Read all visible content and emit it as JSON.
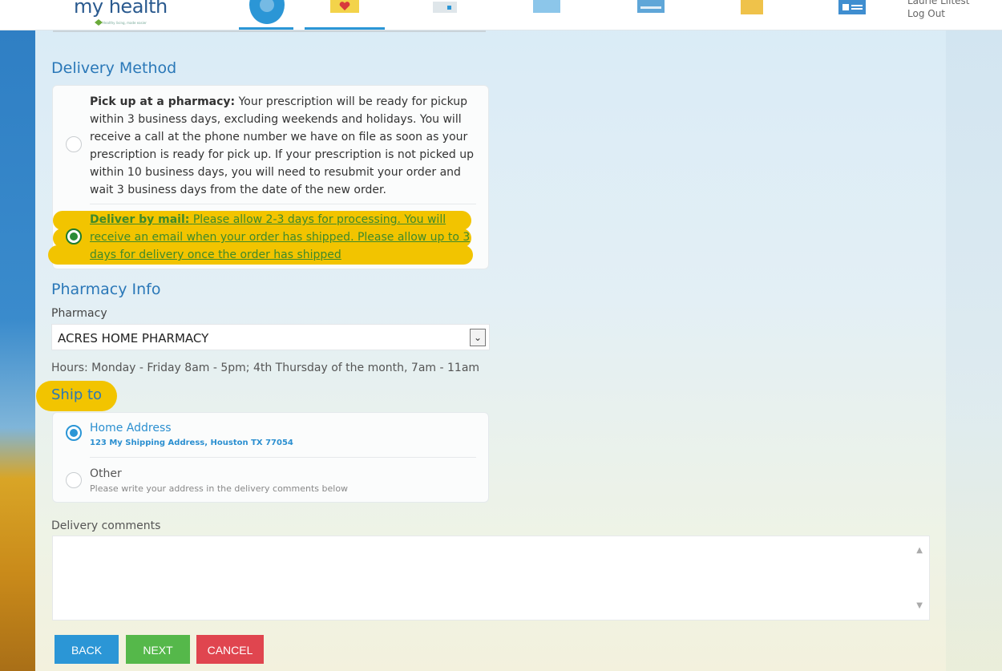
{
  "header": {
    "logo_text": "my health",
    "logo_tagline": "Healthy living, made easier",
    "user_name": "Laurie Liitest",
    "logout_label": "Log Out",
    "nav_icons": [
      "profile-icon",
      "heart-icon",
      "records-icon",
      "messages-icon",
      "card-icon",
      "folder-icon",
      "contact-card-icon"
    ]
  },
  "delivery": {
    "title": "Delivery Method",
    "pickup_bold": "Pick up at a pharmacy:",
    "pickup_text": "Your prescription will be ready for pickup within 3 business days, excluding weekends and holidays. You will receive a call at the phone number we have on file as soon as your prescription is ready for pick up. If your prescription is not picked up within 10 business days, you will need to resubmit your order and wait 3 business days from the date of the new order.",
    "mail_bold": "Deliver by mail:",
    "mail_text": "Please allow 2-3 days for processing. You will receive an email when your order has shipped. Please allow up to 3 days for delivery once the order has shipped",
    "selected": "mail"
  },
  "pharmacy": {
    "title": "Pharmacy Info",
    "label": "Pharmacy",
    "selected_value": "ACRES HOME PHARMACY",
    "hours": "Hours: Monday - Friday 8am - 5pm; 4th Thursday of the month, 7am - 11am"
  },
  "ship_to": {
    "title": "Ship to",
    "home_label": "Home Address",
    "home_address": "123 My Shipping Address, Houston TX 77054",
    "other_label": "Other",
    "other_sub": "Please write your address in the delivery comments below",
    "selected": "home"
  },
  "comments": {
    "label": "Delivery comments",
    "value": ""
  },
  "buttons": {
    "back": "BACK",
    "next": "NEXT",
    "cancel": "CANCEL"
  },
  "colors": {
    "accent_blue": "#2b96d6",
    "highlight_yellow": "#f2c400",
    "back_button": "#2b96d6",
    "next_button": "#55b84a",
    "cancel_button": "#e0454f"
  }
}
